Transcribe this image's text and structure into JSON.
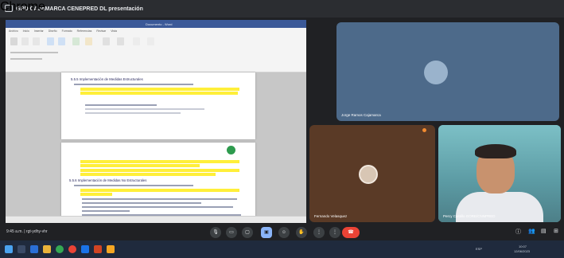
{
  "window": {
    "title": "GRD CAJAMARCA CENEPRED DL presentación",
    "account_badge": "Chrome"
  },
  "shared_screen": {
    "word_title": "Documento - Word",
    "ribbon_tabs": [
      "Archivo",
      "Inicio",
      "Insertar",
      "Diseño",
      "Formato",
      "Referencias",
      "Revisar",
      "Vista"
    ],
    "page1": {
      "heading": "5.5.5   Implementación de Medidas Estructurales",
      "intro": "En el presente estudio, se proponen las siguientes medidas estructurales:",
      "bullet": "Proyectos de infraestructura con el correo adyacente a mover en arteria del y muy alta a movimientos en masa. 1° Plan Piloto: Pedregal Superior & Nuevo.",
      "table_note": "Resumen de Medidas Estructurales"
    },
    "page2": {
      "bullet_a": "Reducción del caudal en las quebradas Fabulo y del sector en el río sur, riesgo muy alto a movimientos en masa.",
      "bullet_b": "Protección frente a las inundaciones en sector de alto y muy alto expuestos urbano: La Berbina, Rosales, Yanamanga.",
      "heading": "5.5.6   Implementación de Medidas No Estructurales",
      "intro": "En el presente estudio, se proponen las siguientes medidas no estructurales:",
      "bullets": [
        "Realizar un inventario de zonas críticas ante inundaciones y movimientos en masa.",
        "Realizar estudios de Evaluación de Riesgo (EVAR) ante inundaciones y movimientos en masa en zonas críticas identificadas.",
        "Realizar estudios de escenarios de riesgo ante inundaciones y movimientos en masa.",
        "Fortalecer capacidades para el acceso a la información y capacidad en Gestión del Riesgo de Desastres (GRD)."
      ]
    }
  },
  "participants": {
    "top": {
      "name": "Jorge Ramos Cajamarca"
    },
    "bottom_left": {
      "name": "Fernando Velasquez"
    },
    "bottom_right": {
      "name": "Percy Castillo GORE/CNNPRED"
    }
  },
  "controls": {
    "meeting_info": "9:45 a.m. | rgt-ydhy-vhr",
    "buttons": [
      "mic",
      "camera",
      "captions",
      "present",
      "emoji",
      "raise-hand",
      "more",
      "end-call"
    ]
  },
  "taskbar": {
    "time": "10:07",
    "date": "12/06/2023",
    "lang": "ESP"
  },
  "colors": {
    "highlight": "#ffef3a",
    "end_call": "#ea4335",
    "active_control": "#8ab4f8"
  }
}
